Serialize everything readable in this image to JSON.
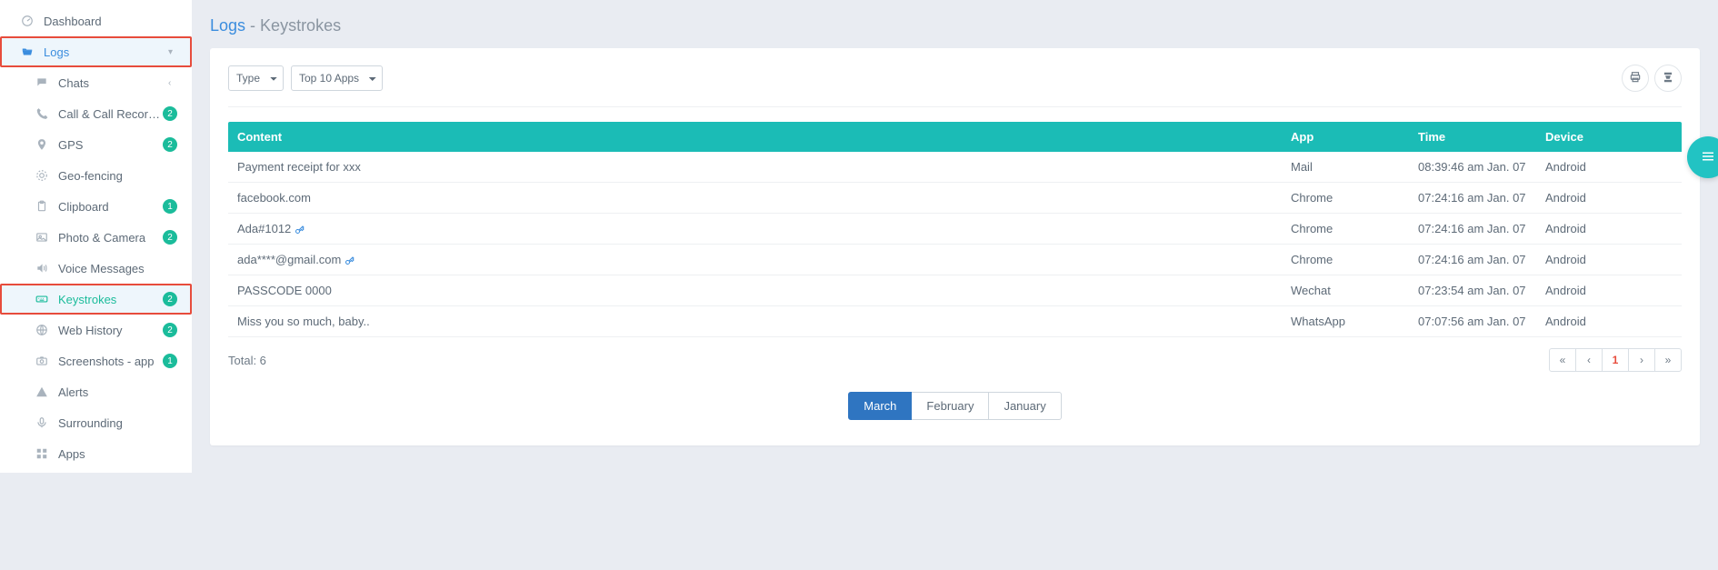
{
  "sidebar": {
    "dashboard": "Dashboard",
    "logs": "Logs",
    "items": [
      {
        "label": "Chats",
        "badge": null,
        "icon": "chat"
      },
      {
        "label": "Call & Call Recording",
        "badge": "2",
        "icon": "phone"
      },
      {
        "label": "GPS",
        "badge": "2",
        "icon": "gps"
      },
      {
        "label": "Geo-fencing",
        "badge": null,
        "icon": "geofence"
      },
      {
        "label": "Clipboard",
        "badge": "1",
        "icon": "clipboard"
      },
      {
        "label": "Photo & Camera",
        "badge": "2",
        "icon": "camera"
      },
      {
        "label": "Voice Messages",
        "badge": null,
        "icon": "voice"
      },
      {
        "label": "Keystrokes",
        "badge": "2",
        "icon": "keyboard"
      },
      {
        "label": "Web History",
        "badge": "2",
        "icon": "globe"
      },
      {
        "label": "Screenshots - app",
        "badge": "1",
        "icon": "screenshot"
      },
      {
        "label": "Alerts",
        "badge": null,
        "icon": "alert"
      },
      {
        "label": "Surrounding",
        "badge": null,
        "icon": "mic"
      },
      {
        "label": "Apps",
        "badge": null,
        "icon": "apps"
      }
    ]
  },
  "header": {
    "title_main": "Logs",
    "title_sep": " - ",
    "title_sub": "Keystrokes"
  },
  "toolbar": {
    "type_label": "Type",
    "apps_label": "Top 10 Apps"
  },
  "table": {
    "columns": {
      "content": "Content",
      "app": "App",
      "time": "Time",
      "device": "Device"
    },
    "rows": [
      {
        "content": "Payment receipt for xxx",
        "key": false,
        "app": "Mail",
        "time": "08:39:46 am Jan. 07",
        "device": "Android"
      },
      {
        "content": "facebook.com",
        "key": false,
        "app": "Chrome",
        "time": "07:24:16 am Jan. 07",
        "device": "Android"
      },
      {
        "content": "Ada#1012",
        "key": true,
        "app": "Chrome",
        "time": "07:24:16 am Jan. 07",
        "device": "Android"
      },
      {
        "content": "ada****@gmail.com",
        "key": true,
        "app": "Chrome",
        "time": "07:24:16 am Jan. 07",
        "device": "Android"
      },
      {
        "content": "PASSCODE 0000",
        "key": false,
        "app": "Wechat",
        "time": "07:23:54 am Jan. 07",
        "device": "Android"
      },
      {
        "content": "Miss you so much, baby..",
        "key": false,
        "app": "WhatsApp",
        "time": "07:07:56 am Jan. 07",
        "device": "Android"
      }
    ],
    "total_label": "Total: 6"
  },
  "pagination": {
    "current": "1"
  },
  "months": {
    "items": [
      "March",
      "February",
      "January"
    ],
    "active_index": 0
  }
}
